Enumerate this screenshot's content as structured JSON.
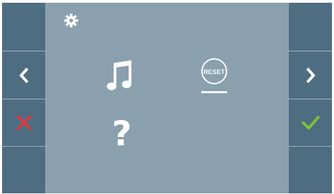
{
  "screen": {
    "title_icon": "gear-icon",
    "menu_items": [
      {
        "icon": "music-note-icon"
      },
      {
        "icon": "reset-icon",
        "label": "RESET"
      },
      {
        "icon": "question-mark-icon"
      }
    ]
  },
  "left_panel": {
    "back_icon": "chevron-left-icon",
    "cancel_icon": "close-icon"
  },
  "right_panel": {
    "forward_icon": "chevron-right-icon",
    "confirm_icon": "check-icon"
  },
  "colors": {
    "panel": "#4f6d81",
    "background": "#8aa0ae",
    "cancel": "#e03a3a",
    "confirm": "#7cc23a",
    "icon": "#ffffff"
  }
}
